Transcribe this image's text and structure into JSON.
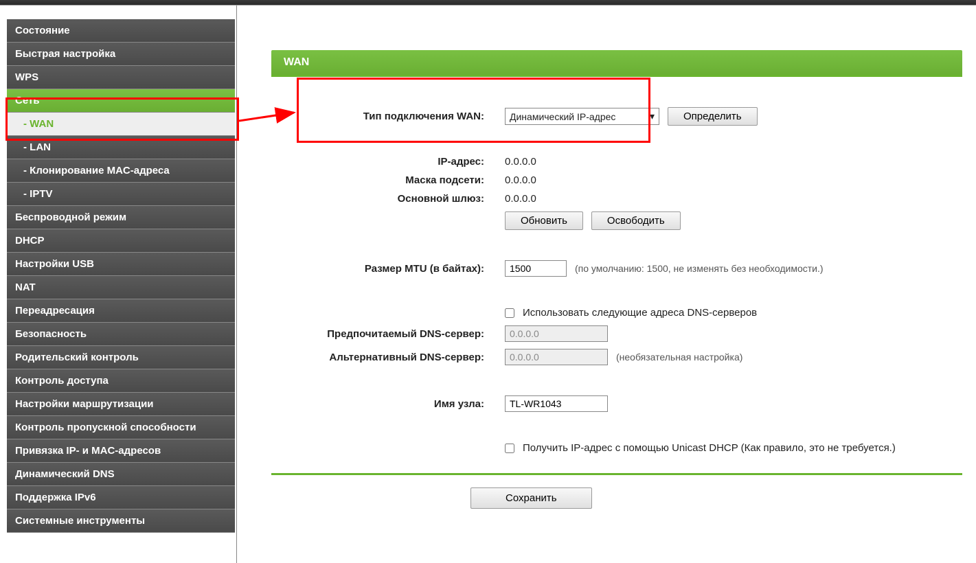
{
  "sidebar": {
    "items": [
      {
        "label": "Состояние",
        "type": "top"
      },
      {
        "label": "Быстрая настройка",
        "type": "top"
      },
      {
        "label": "WPS",
        "type": "top"
      },
      {
        "label": "Сеть",
        "type": "top",
        "active": true
      },
      {
        "label": "- WAN",
        "type": "sub",
        "active_sub": true
      },
      {
        "label": "- LAN",
        "type": "sub"
      },
      {
        "label": "- Клонирование MAC-адреса",
        "type": "sub"
      },
      {
        "label": "- IPTV",
        "type": "sub"
      },
      {
        "label": "Беспроводной режим",
        "type": "top"
      },
      {
        "label": "DHCP",
        "type": "top"
      },
      {
        "label": "Настройки USB",
        "type": "top"
      },
      {
        "label": "NAT",
        "type": "top"
      },
      {
        "label": "Переадресация",
        "type": "top"
      },
      {
        "label": "Безопасность",
        "type": "top"
      },
      {
        "label": "Родительский контроль",
        "type": "top"
      },
      {
        "label": "Контроль доступа",
        "type": "top"
      },
      {
        "label": "Настройки маршрутизации",
        "type": "top"
      },
      {
        "label": "Контроль пропускной способности",
        "type": "top"
      },
      {
        "label": "Привязка IP- и MAC-адресов",
        "type": "top"
      },
      {
        "label": "Динамический DNS",
        "type": "top"
      },
      {
        "label": "Поддержка IPv6",
        "type": "top"
      },
      {
        "label": "Системные инструменты",
        "type": "top"
      }
    ]
  },
  "page": {
    "title": "WAN",
    "labels": {
      "wan_type": "Тип подключения WAN:",
      "ip": "IP-адрес:",
      "mask": "Маска подсети:",
      "gateway": "Основной шлюз:",
      "mtu": "Размер MTU (в байтах):",
      "dns_pref": "Предпочитаемый DNS-сервер:",
      "dns_alt": "Альтернативный DNS-сервер:",
      "hostname": "Имя узла:"
    },
    "values": {
      "wan_type_selected": "Динамический IP-адрес",
      "ip": "0.0.0.0",
      "mask": "0.0.0.0",
      "gateway": "0.0.0.0",
      "mtu": "1500",
      "dns_pref": "0.0.0.0",
      "dns_alt": "0.0.0.0",
      "hostname": "TL-WR1043"
    },
    "buttons": {
      "detect": "Определить",
      "renew": "Обновить",
      "release": "Освободить",
      "save": "Сохранить"
    },
    "hints": {
      "mtu": "(по умолчанию: 1500, не изменять без необходимости.)",
      "dns_alt": "(необязательная настройка)"
    },
    "checkboxes": {
      "use_dns": "Использовать следующие адреса DNS-серверов",
      "unicast": "Получить IP-адрес с помощью Unicast DHCP (Как правило, это не требуется.)"
    }
  }
}
